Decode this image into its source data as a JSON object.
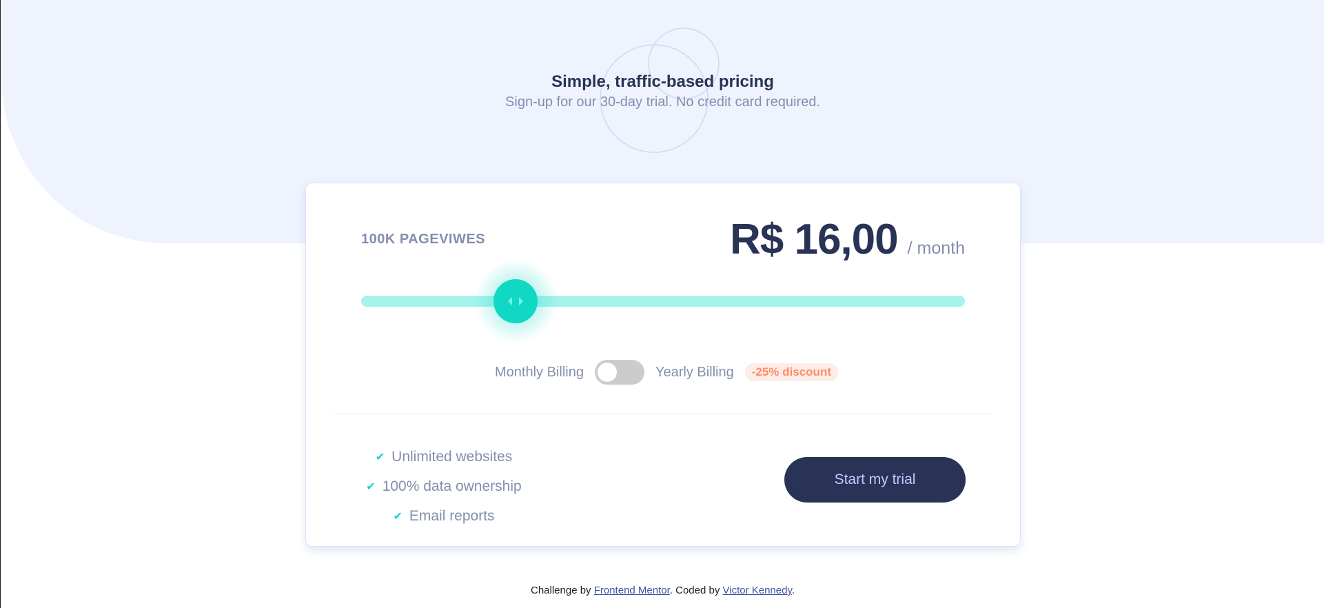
{
  "header": {
    "title": "Simple, traffic-based pricing",
    "subtitle": "Sign-up for our 30-day trial. No credit card required."
  },
  "pricing": {
    "pageviews_label": "100K PAGEVIWES",
    "price": "R$ 16,00",
    "period": "/ month",
    "slider_level": 0.3
  },
  "billing": {
    "monthly_label": "Monthly Billing",
    "yearly_label": "Yearly Billing",
    "discount_label": "-25% discount",
    "yearly_enabled": false
  },
  "features": [
    "Unlimited websites",
    "100% data ownership",
    "Email reports"
  ],
  "cta": {
    "label": "Start my trial"
  },
  "attribution": {
    "prefix": "Challenge by ",
    "challenge_link": "Frontend Mentor",
    "middle": ". Coded by ",
    "author_link": "Victor Kennedy",
    "suffix": "."
  },
  "colors": {
    "background_tint": "#eef3fe",
    "heading": "#293356",
    "muted_text": "#848ead",
    "accent": "#10d8c4",
    "slider_track": "#a5f3eb",
    "discount_text": "#ff8d68",
    "discount_bg": "#feece7",
    "cta_bg": "#293356",
    "cta_text": "#bdccff"
  }
}
